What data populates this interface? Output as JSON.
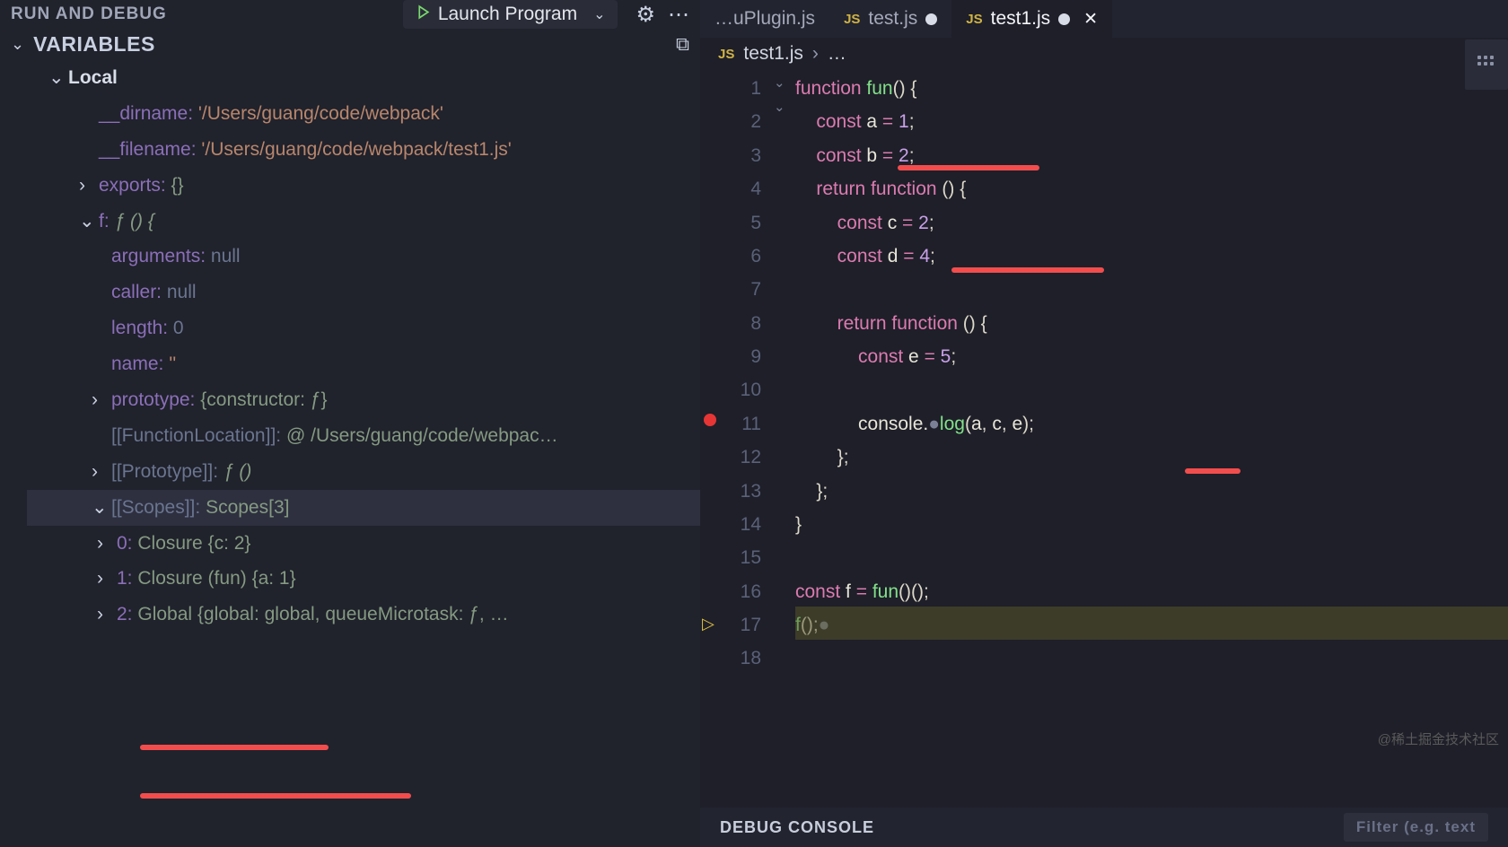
{
  "header": {
    "run_debug": "RUN AND DEBUG",
    "launch": "Launch Program"
  },
  "variables": {
    "section": "VARIABLES",
    "local": "Local",
    "dirname_k": "__dirname:",
    "dirname_v": "'/Users/guang/code/webpack'",
    "filename_k": "__filename:",
    "filename_v": "'/Users/guang/code/webpack/test1.js'",
    "exports_k": "exports:",
    "exports_v": "{}",
    "f_k": "f:",
    "f_v": "ƒ () {",
    "arguments_k": "arguments:",
    "arguments_v": "null",
    "caller_k": "caller:",
    "caller_v": "null",
    "length_k": "length:",
    "length_v": "0",
    "name_k": "name:",
    "name_v": "''",
    "proto_k": "prototype:",
    "proto_v": "{constructor: ƒ}",
    "funcloc_k": "[[FunctionLocation]]:",
    "funcloc_v": "@ /Users/guang/code/webpac…",
    "protointernal_k": "[[Prototype]]:",
    "protointernal_v": "ƒ ()",
    "scopes_k": "[[Scopes]]:",
    "scopes_v": "Scopes[3]",
    "scope0_k": "0:",
    "scope0_v": "Closure {c: 2}",
    "scope1_k": "1:",
    "scope1_v": "Closure (fun) {a: 1}",
    "scope2_k": "2:",
    "scope2_v": "Global {global: global, queueMicrotask: ƒ, …"
  },
  "tabs": {
    "t0": "…uPlugin.js",
    "t1": "test.js",
    "t2": "test1.js"
  },
  "breadcrumb": {
    "file": "test1.js",
    "more": "…"
  },
  "code": {
    "lines": [
      "1",
      "2",
      "3",
      "4",
      "5",
      "6",
      "7",
      "8",
      "9",
      "10",
      "11",
      "12",
      "13",
      "14",
      "15",
      "16",
      "17",
      "18"
    ],
    "l1a": "function ",
    "l1b": "fun",
    "l1c": "() {",
    "l2a": "    const ",
    "l2b": "a ",
    "l2c": "= ",
    "l2d": "1",
    "l2e": ";",
    "l3a": "    const ",
    "l3b": "b ",
    "l3c": "= ",
    "l3d": "2",
    "l3e": ";",
    "l4a": "    return ",
    "l4b": "function ",
    "l4c": "() {",
    "l5a": "        const ",
    "l5b": "c ",
    "l5c": "= ",
    "l5d": "2",
    "l5e": ";",
    "l6a": "        const ",
    "l6b": "d ",
    "l6c": "= ",
    "l6d": "4",
    "l6e": ";",
    "l8a": "        return ",
    "l8b": "function ",
    "l8c": "() {",
    "l9a": "            const ",
    "l9b": "e ",
    "l9c": "= ",
    "l9d": "5",
    "l9e": ";",
    "l11a": "            console.",
    "l11b": "log",
    "l11c": "(",
    "l11d": "a",
    "l11e": ", ",
    "l11f": "c",
    "l11g": ", ",
    "l11h": "e",
    "l11i": ");",
    "l12": "        };",
    "l13": "    };",
    "l14": "}",
    "l16a": "const ",
    "l16b": "f ",
    "l16c": "= ",
    "l16d": "fun",
    "l16e": "()();",
    "l17a": "f",
    "l17b": "();"
  },
  "console": {
    "label": "DEBUG CONSOLE",
    "filter": "Filter (e.g. text"
  },
  "watermark": "@稀土掘金技术社区"
}
